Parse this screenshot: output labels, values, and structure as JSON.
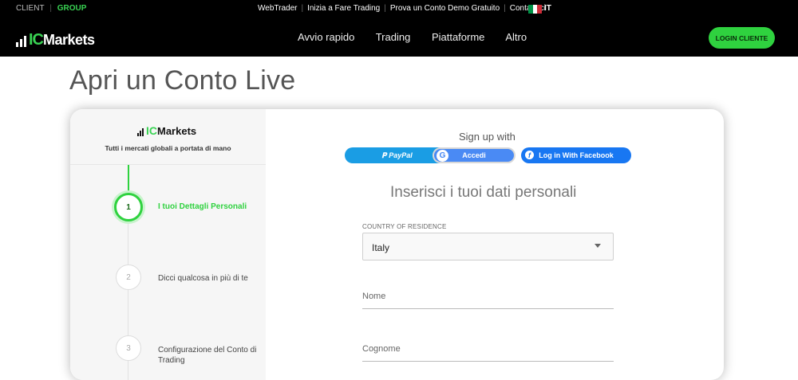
{
  "header": {
    "util_left": {
      "client": "CLIENT",
      "separator": "|",
      "group": "GROUP"
    },
    "util_links": [
      "WebTrader",
      "Inizia a Fare Trading",
      "Prova un Conto Demo Gratuito",
      "Contattaci"
    ],
    "language": "IT",
    "flag_colors": [
      "#009246",
      "#ffffff",
      "#ce2b37"
    ],
    "logo": {
      "ic": "IC",
      "markets": "Markets"
    },
    "nav": [
      "Avvio rapido",
      "Trading",
      "Piattaforme",
      "Altro"
    ],
    "login_button": "LOGIN CLIENTE"
  },
  "page_title": "Apri un Conto Live",
  "sidebar": {
    "logo": {
      "ic": "IC",
      "markets": "Markets"
    },
    "tagline": "Tutti i mercati globali a portata di mano",
    "steps": [
      {
        "number": "1",
        "label": "I tuoi Dettagli Personali",
        "active": true
      },
      {
        "number": "2",
        "label": "Dicci qualcosa in più di te",
        "active": false
      },
      {
        "number": "3",
        "label": "Configurazione del Conto di Trading",
        "active": false
      }
    ]
  },
  "form": {
    "signup_with": "Sign up with",
    "paypal_label": "PayPal",
    "google_label": "Accedi",
    "facebook_label": "Log in With Facebook",
    "subtitle": "Inserisci i tuoi dati personali",
    "country_label": "COUNTRY OF RESIDENCE",
    "country_value": "Italy",
    "first_name_placeholder": "Nome",
    "last_name_placeholder": "Cognome"
  },
  "colors": {
    "accent_green": "#2fd23f",
    "paypal_blue": "#1a9de4",
    "google_blue": "#4a8af4",
    "facebook_blue": "#1877f2"
  }
}
